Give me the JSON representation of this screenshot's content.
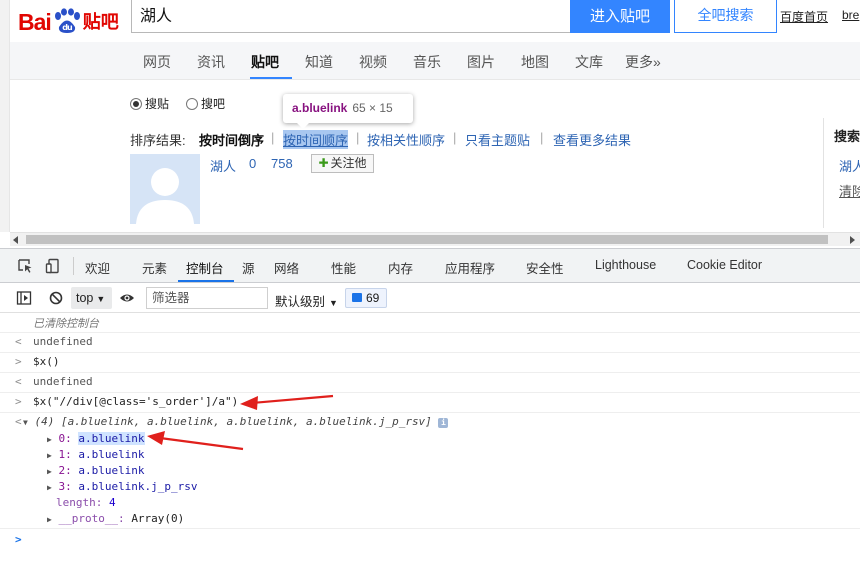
{
  "header": {
    "logo_main": "Bai",
    "logo_tail": "贴吧",
    "search_value": "湖人",
    "enter_button": "进入贴吧",
    "search_all_button": "全吧搜索",
    "link_home": "百度首页",
    "link_user": "bre"
  },
  "nav": {
    "items": [
      "网页",
      "资讯",
      "贴吧",
      "知道",
      "视频",
      "音乐",
      "图片",
      "地图",
      "文库",
      "更多»"
    ],
    "active": "贴吧"
  },
  "search": {
    "radio_tie": "搜贴",
    "radio_ba": "搜吧"
  },
  "sort": {
    "label": "排序结果:",
    "by_time_desc": "按时间倒序",
    "sep": "|",
    "by_time_asc": "按时间顺序",
    "by_relevance": "按相关性顺序",
    "only_topic": "只看主题贴",
    "more_results": "查看更多结果"
  },
  "forum": {
    "name": "湖人",
    "members": "0",
    "posts": "758",
    "follow": "关注他"
  },
  "right_col": {
    "title": "搜索",
    "item1": "湖人",
    "item2": "清除"
  },
  "tooltip": {
    "element": "a.bluelink",
    "size": "65 × 15"
  },
  "devtools": {
    "tabs": [
      "欢迎",
      "元素",
      "控制台",
      "源",
      "网络",
      "性能",
      "内存",
      "应用程序",
      "安全性",
      "Lighthouse",
      "Cookie Editor"
    ],
    "active_tab": "控制台",
    "toolbar": {
      "context": "top",
      "filter_placeholder": "筛选器",
      "level": "默认级别",
      "issues_count": "69"
    },
    "console": {
      "cleared": "已清除控制台",
      "out1": "undefined",
      "in1": "$x()",
      "out2": "undefined",
      "in2": "$x(\"//div[@class='s_order']/a\")",
      "result_summary": "(4) [a.bluelink, a.bluelink, a.bluelink, a.bluelink.j_p_rsv]",
      "items": [
        {
          "index": "0:",
          "value": "a.bluelink"
        },
        {
          "index": "1:",
          "value": "a.bluelink"
        },
        {
          "index": "2:",
          "value": "a.bluelink"
        },
        {
          "index": "3:",
          "value": "a.bluelink.j_p_rsv"
        }
      ],
      "length_label": "length:",
      "length_value": "4",
      "proto_label": "__proto__:",
      "proto_value": "Array(0)",
      "marker_in": ">",
      "marker_out": "<",
      "info_icon": "i"
    }
  },
  "colors": {
    "baidu_red": "#e10602",
    "baidu_blue": "#3385ff",
    "link_blue": "#2d64b3",
    "annotation_red": "#e0201c"
  }
}
